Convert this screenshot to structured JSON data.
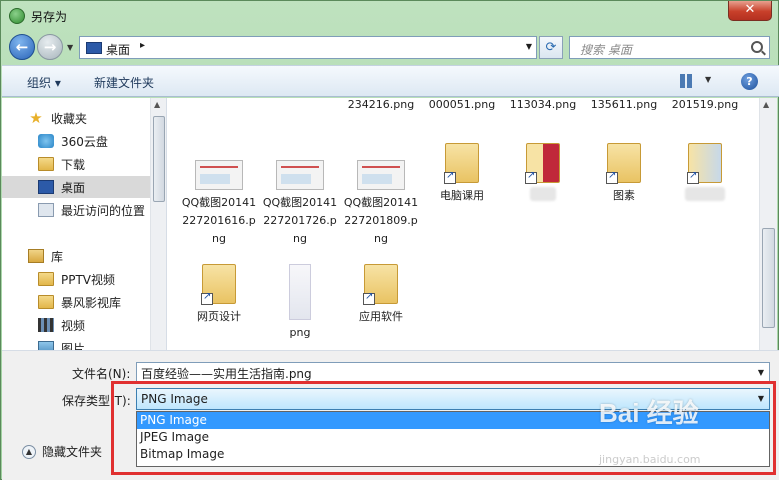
{
  "window": {
    "title": "另存为",
    "close_symbol": "✕"
  },
  "address": {
    "location": "桌面",
    "separator": "▸",
    "search_placeholder": "搜索 桌面"
  },
  "toolbar": {
    "organize": "组织 ▾",
    "new_folder": "新建文件夹",
    "help": "?"
  },
  "nav": {
    "items": [
      {
        "label": "收藏夹",
        "icon": "star-icon"
      },
      {
        "label": "360云盘",
        "icon": "cloud-icon"
      },
      {
        "label": "下载",
        "icon": "folder-icon"
      },
      {
        "label": "桌面",
        "icon": "desktop-icon",
        "selected": true
      },
      {
        "label": "最近访问的位置",
        "icon": "recent-icon"
      },
      {
        "label": "库",
        "icon": "library-icon"
      },
      {
        "label": "PPTV视频",
        "icon": "folder-icon"
      },
      {
        "label": "暴风影视库",
        "icon": "folder-icon"
      },
      {
        "label": "视频",
        "icon": "film-icon"
      },
      {
        "label": "图片",
        "icon": "picture-icon"
      }
    ]
  },
  "files": {
    "row1": [
      "234216.png",
      "000051.png",
      "113034.png",
      "135611.png",
      "201519.png"
    ],
    "row2": [
      {
        "name": "QQ截图20141227201616.png",
        "type": "image"
      },
      {
        "name": "QQ截图20141227201726.png",
        "type": "image"
      },
      {
        "name": "QQ截图20141227201809.png",
        "type": "image"
      },
      {
        "name": "电脑课用",
        "type": "folder-shortcut"
      },
      {
        "name": "",
        "type": "folder-shortcut-blurred"
      },
      {
        "name": "图素",
        "type": "folder-shortcut"
      },
      {
        "name": "",
        "type": "folder-shortcut-blurred"
      }
    ],
    "row3": [
      {
        "name": "网页设计",
        "type": "folder-shortcut"
      },
      {
        "name": "png",
        "type": "image-blurred"
      },
      {
        "name": "应用软件",
        "type": "folder-shortcut"
      }
    ]
  },
  "form": {
    "filename_label": "文件名(N):",
    "filename_value": "百度经验——实用生活指南.png",
    "savetype_label": "保存类型(T):",
    "savetype_value": "PNG Image",
    "savetype_options": [
      "PNG Image",
      "JPEG Image",
      "Bitmap Image"
    ],
    "hide_folders": "隐藏文件夹"
  },
  "watermark": {
    "text": "Bai 经验",
    "sub": "jingyan.baidu.com"
  },
  "colors": {
    "highlight": "#3399ff",
    "annotation": "#e03030"
  }
}
